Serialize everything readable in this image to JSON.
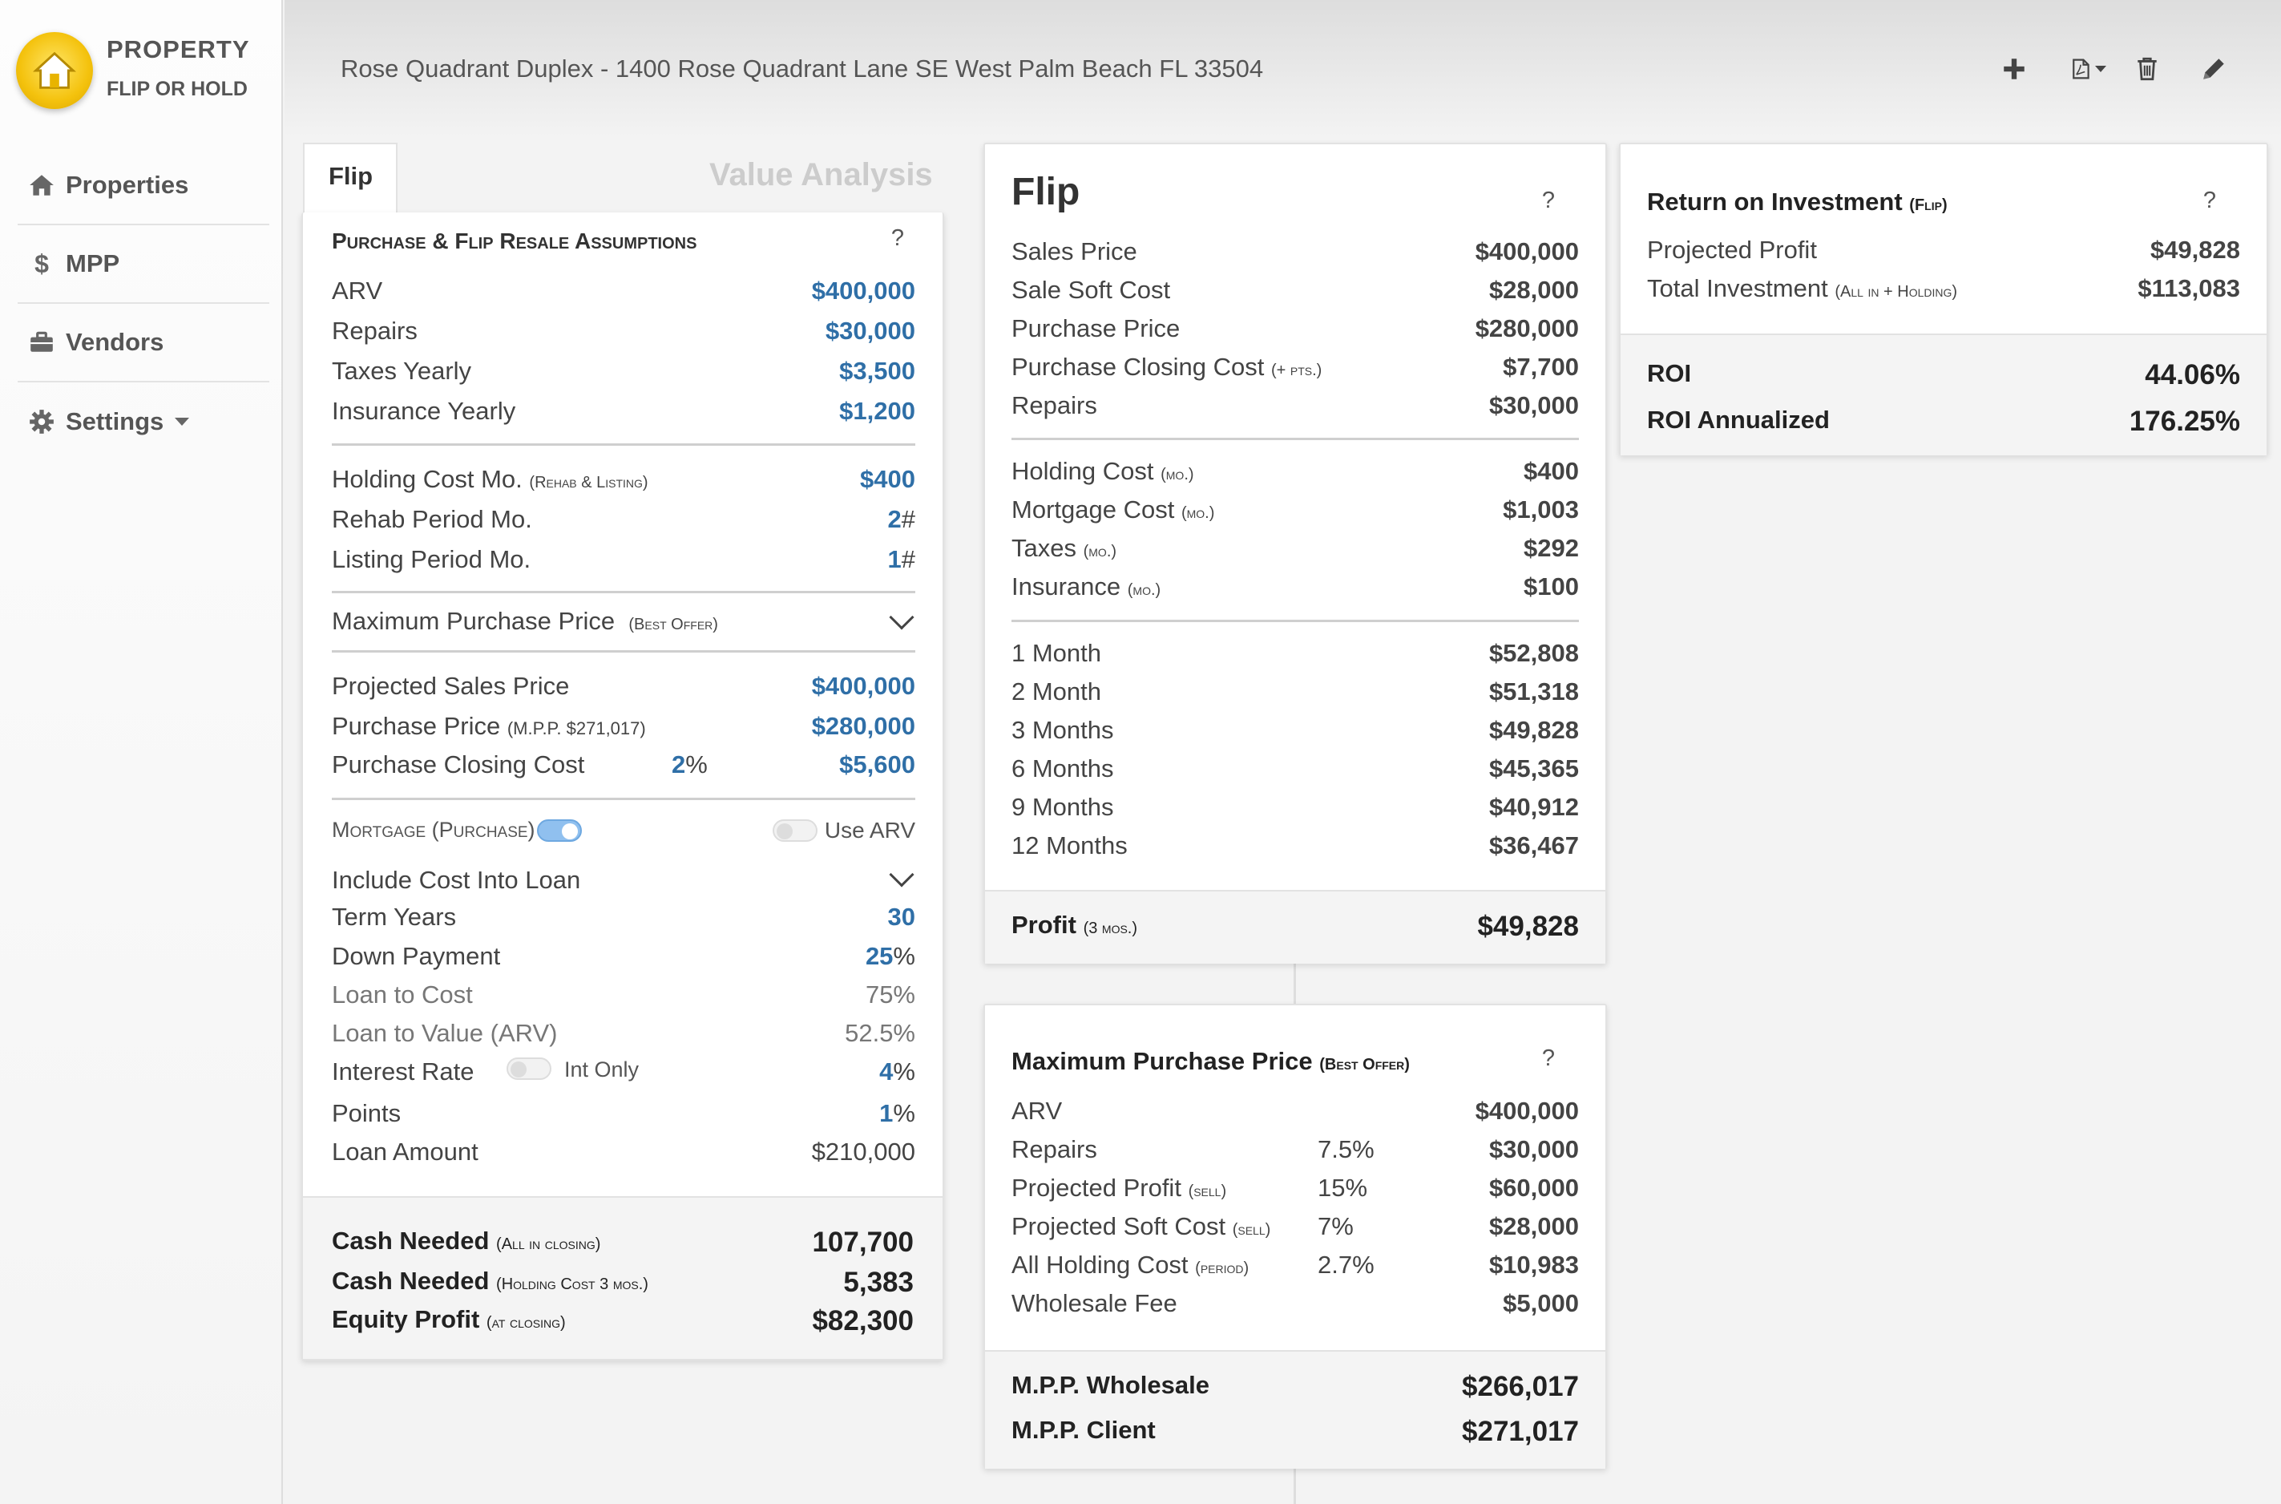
{
  "sidebar": {
    "brand_line1": "PROPERTY",
    "brand_line2": "FLIP OR HOLD",
    "items": [
      {
        "label": "Properties",
        "icon": "home-icon"
      },
      {
        "label": "MPP",
        "icon": "dollar-icon"
      },
      {
        "label": "Vendors",
        "icon": "briefcase-icon"
      },
      {
        "label": "Settings",
        "icon": "gear-icon"
      }
    ]
  },
  "header": {
    "title": "Rose Quadrant Duplex - 1400 Rose Quadrant Lane SE West Palm Beach FL 33504",
    "actions": [
      "plus-icon",
      "pdf-icon",
      "trash-icon",
      "pencil-icon"
    ]
  },
  "tabs": {
    "active": "Flip",
    "other": "Value Analysis"
  },
  "assumptions": {
    "heading": "Purchase & Flip Resale Assumptions",
    "help": "?",
    "arv": {
      "label": "ARV",
      "value": "$400,000"
    },
    "repairs": {
      "label": "Repairs",
      "value": "$30,000"
    },
    "taxes": {
      "label": "Taxes Yearly",
      "value": "$3,500"
    },
    "insurance": {
      "label": "Insurance Yearly",
      "value": "$1,200"
    },
    "holding": {
      "label": "Holding Cost Mo.",
      "sub": "(Rehab & Listing)",
      "value": "$400"
    },
    "rehab": {
      "label": "Rehab Period Mo.",
      "value": "2",
      "unit": "#"
    },
    "listing": {
      "label": "Listing Period Mo.",
      "value": "1",
      "unit": "#"
    },
    "mpp": {
      "label": "Maximum Purchase Price",
      "sub": "(Best Offer)"
    },
    "proj_sales": {
      "label": "Projected Sales Price",
      "value": "$400,000"
    },
    "purchase": {
      "label": "Purchase Price",
      "sub": "(M.P.P. $271,017)",
      "value": "$280,000"
    },
    "closing": {
      "label": "Purchase Closing Cost",
      "pct": "2",
      "unit": "%",
      "value": "$5,600"
    },
    "mortgage": {
      "label": "Mortgage (Purchase)",
      "use_arv": "Use ARV"
    },
    "include": {
      "label": "Include Cost Into Loan"
    },
    "term": {
      "label": "Term Years",
      "value": "30"
    },
    "down": {
      "label": "Down Payment",
      "value": "25",
      "unit": "%"
    },
    "ltc": {
      "label": "Loan to Cost",
      "value": "75%"
    },
    "ltv": {
      "label": "Loan to Value (ARV)",
      "value": "52.5%"
    },
    "rate": {
      "label": "Interest Rate",
      "toggle": "Int Only",
      "value": "4",
      "unit": "%"
    },
    "points": {
      "label": "Points",
      "value": "1",
      "unit": "%"
    },
    "loan": {
      "label": "Loan Amount",
      "value": "$210,000"
    },
    "cash1": {
      "label": "Cash Needed",
      "sub": "(All in closing)",
      "value": "107,700"
    },
    "cash2": {
      "label": "Cash Needed",
      "sub": "(Holding Cost 3 mos.)",
      "value": "5,383"
    },
    "equity": {
      "label": "Equity Profit",
      "sub": "(at closing)",
      "value": "$82,300"
    }
  },
  "flip": {
    "title": "Flip",
    "help": "?",
    "rows1": [
      {
        "label": "Sales Price",
        "value": "$400,000"
      },
      {
        "label": "Sale Soft Cost",
        "value": "$28,000"
      },
      {
        "label": "Purchase Price",
        "value": "$280,000"
      },
      {
        "label": "Purchase Closing Cost",
        "sub": "(+ pts.)",
        "value": "$7,700"
      },
      {
        "label": "Repairs",
        "value": "$30,000"
      }
    ],
    "rows2": [
      {
        "label": "Holding Cost",
        "sub": "(mo.)",
        "value": "$400"
      },
      {
        "label": "Mortgage Cost",
        "sub": "(mo.)",
        "value": "$1,003"
      },
      {
        "label": "Taxes",
        "sub": "(mo.)",
        "value": "$292"
      },
      {
        "label": "Insurance",
        "sub": "(mo.)",
        "value": "$100"
      }
    ],
    "rows3": [
      {
        "label": "1 Month",
        "value": "$52,808"
      },
      {
        "label": "2 Month",
        "value": "$51,318"
      },
      {
        "label": "3 Months",
        "value": "$49,828"
      },
      {
        "label": "6 Months",
        "value": "$45,365"
      },
      {
        "label": "9 Months",
        "value": "$40,912"
      },
      {
        "label": "12 Months",
        "value": "$36,467"
      }
    ],
    "profit": {
      "label": "Profit",
      "sub": "(3 mos.)",
      "value": "$49,828"
    }
  },
  "mpp_card": {
    "title": "Maximum Purchase Price",
    "sub": "(Best Offer)",
    "help": "?",
    "rows": [
      {
        "label": "ARV",
        "pct": "",
        "value": "$400,000"
      },
      {
        "label": "Repairs",
        "pct": "7.5%",
        "value": "$30,000"
      },
      {
        "label": "Projected Profit",
        "sub": "(sell)",
        "pct": "15%",
        "value": "$60,000"
      },
      {
        "label": "Projected Soft Cost",
        "sub": "(sell)",
        "pct": "7%",
        "value": "$28,000"
      },
      {
        "label": "All Holding Cost",
        "sub": "(period)",
        "pct": "2.7%",
        "value": "$10,983"
      },
      {
        "label": "Wholesale Fee",
        "pct": "",
        "value": "$5,000"
      }
    ],
    "wholesale": {
      "label": "M.P.P. Wholesale",
      "value": "$266,017"
    },
    "client": {
      "label": "M.P.P. Client",
      "value": "$271,017"
    }
  },
  "roi": {
    "title": "Return on Investment",
    "sub": "(Flip)",
    "help": "?",
    "profit": {
      "label": "Projected Profit",
      "value": "$49,828"
    },
    "investment": {
      "label": "Total Investment",
      "sub": "(All in + Holding)",
      "value": "$113,083"
    },
    "roi": {
      "label": "ROI",
      "value": "44.06%"
    },
    "annual": {
      "label": "ROI Annualized",
      "value": "176.25%"
    }
  }
}
